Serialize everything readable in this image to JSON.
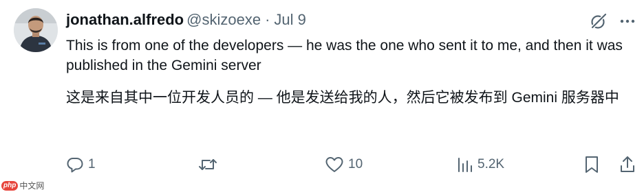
{
  "user": {
    "display_name": "jonathan.alfredo",
    "handle": "@skizoexe",
    "separator": "·",
    "date": "Jul 9"
  },
  "tweet": {
    "text_en": "This is from one of the developers — he was the one who sent it to me, and then it was published in the Gemini server",
    "text_zh": "这是来自其中一位开发人员的 — 他是发送给我的人，然后它被发布到 Gemini 服务器中"
  },
  "actions": {
    "replies": "1",
    "retweets": "",
    "likes": "10",
    "views": "5.2K"
  },
  "icons": {
    "grok": "grok-icon",
    "more": "more-icon",
    "reply": "reply-icon",
    "retweet": "retweet-icon",
    "like": "heart-icon",
    "views": "views-icon",
    "bookmark": "bookmark-icon",
    "share": "share-icon"
  },
  "colors": {
    "text": "#0f1419",
    "muted": "#536471",
    "background": "#ffffff"
  },
  "watermark": {
    "badge": "php",
    "text": "中文网"
  }
}
